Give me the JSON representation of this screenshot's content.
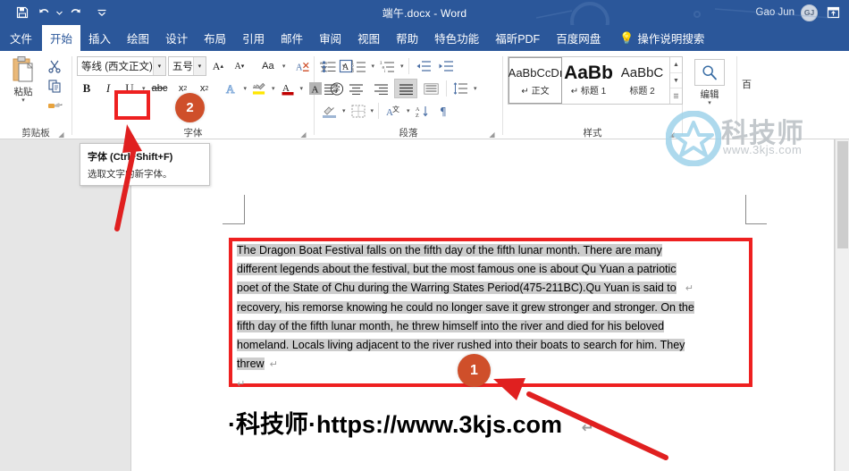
{
  "titlebar": {
    "document_title": "端午.docx  -  Word",
    "user_name": "Gao Jun",
    "avatar_initials": "GJ",
    "quick_access": [
      {
        "name": "save-icon",
        "label": "保存"
      },
      {
        "name": "undo-icon",
        "label": "撤消"
      },
      {
        "name": "redo-icon",
        "label": "恢复"
      },
      {
        "name": "customize-qat-icon",
        "label": "自定义快速访问工具栏"
      }
    ],
    "ribbon_display_options": "功能区显示选项"
  },
  "tabs": [
    {
      "label": "文件",
      "active": false
    },
    {
      "label": "开始",
      "active": true
    },
    {
      "label": "插入",
      "active": false
    },
    {
      "label": "绘图",
      "active": false
    },
    {
      "label": "设计",
      "active": false
    },
    {
      "label": "布局",
      "active": false
    },
    {
      "label": "引用",
      "active": false
    },
    {
      "label": "邮件",
      "active": false
    },
    {
      "label": "审阅",
      "active": false
    },
    {
      "label": "视图",
      "active": false
    },
    {
      "label": "帮助",
      "active": false
    },
    {
      "label": "特色功能",
      "active": false
    },
    {
      "label": "福昕PDF",
      "active": false
    },
    {
      "label": "百度网盘",
      "active": false
    }
  ],
  "tell_me": "操作说明搜索",
  "ribbon": {
    "clipboard": {
      "group_label": "剪贴板",
      "paste_label": "粘贴",
      "cut_label": "剪切",
      "copy_label": "复制",
      "format_painter_label": "格式刷"
    },
    "font": {
      "group_label": "字体",
      "font_name": "等线 (西文正文)",
      "font_size": "五号",
      "grow_font": "增大字号",
      "shrink_font": "减小字号",
      "change_case": "Aa",
      "clear_formatting": "清除所有格式",
      "phonetic_guide": "拼音指南",
      "char_border": "字符边框",
      "bold": "B",
      "italic": "I",
      "underline": "U",
      "strikethrough": "abc",
      "subscript": "x",
      "superscript": "x",
      "text_effects": "文本效果和版式",
      "highlight": "文本突出显示颜色",
      "font_color": "字体颜色",
      "char_shading": "字符底纹",
      "enclose_char": "带圈字符"
    },
    "paragraph": {
      "group_label": "段落",
      "bullets": "项目符号",
      "numbering": "编号",
      "multilevel": "多级列表",
      "decrease_indent": "减少缩进量",
      "increase_indent": "增加缩进量",
      "align_left": "左对齐",
      "align_center": "居中",
      "align_right": "右对齐",
      "justify": "两端对齐",
      "distribute": "分散对齐",
      "line_spacing": "行和段落间距",
      "shading": "底纹",
      "borders": "边框",
      "sort": "排序",
      "show_marks": "显示/隐藏编辑标记",
      "cn_layout": "中文版式"
    },
    "styles": {
      "group_label": "样式",
      "items": [
        {
          "preview": "AaBbCcDı",
          "name": "正文",
          "selected": true,
          "mark": "↵"
        },
        {
          "preview": "AaBb",
          "name": "标题 1",
          "selected": false,
          "mark": "↵"
        },
        {
          "preview": "AaBbC",
          "name": "标题 2",
          "selected": false,
          "mark": ""
        }
      ]
    },
    "editing": {
      "group_label": "编辑",
      "button_label": "编辑",
      "icon": "search-icon"
    },
    "clipped_right": "百"
  },
  "tooltip": {
    "title": "字体 (Ctrl+Shift+F)",
    "description": "选取文字的新字体。"
  },
  "markers": [
    {
      "number": "2",
      "target": "underline-button"
    },
    {
      "number": "1",
      "target": "selected-paragraph"
    }
  ],
  "document": {
    "lines": [
      {
        "text": "The Dragon Boat Festival falls on the fifth day of the fifth lunar month. There are many",
        "selected": true
      },
      {
        "text": "different legends about the festival, but the most famous one is about Qu Yuan a patriotic",
        "selected": true
      },
      {
        "text": "poet of the State of Chu during the Warring States Period(475-211BC).Qu Yuan is said to",
        "selected": true,
        "mark": "↵"
      },
      {
        "text": "recovery, his remorse knowing he could no longer save it grew stronger and stronger. On the",
        "selected": true
      },
      {
        "text": "fifth day of the fifth lunar month, he threw himself into the river and died for his beloved",
        "selected": true
      },
      {
        "text": "homeland. Locals living adjacent to the river rushed into their boats to search for him. They",
        "selected": true
      },
      {
        "text": "threw",
        "selected": true,
        "mark": "↵"
      },
      {
        "text": "",
        "selected": false,
        "mark": "↵"
      }
    ],
    "misspelled_word": "Qu",
    "footer_line": "·科技师·https://www.3kjs.com",
    "footer_mark": "↵"
  },
  "watermark": {
    "brand": "科技师",
    "url": "www.3kjs.com"
  },
  "colors": {
    "titlebar_blue": "#2b579a",
    "accent_red": "#ee2020",
    "marker_orange": "#cf4f2a",
    "selection_gray": "#cdcdcd",
    "page_background": "#e6e6e6",
    "watermark_gray": "#b9bfc4"
  }
}
